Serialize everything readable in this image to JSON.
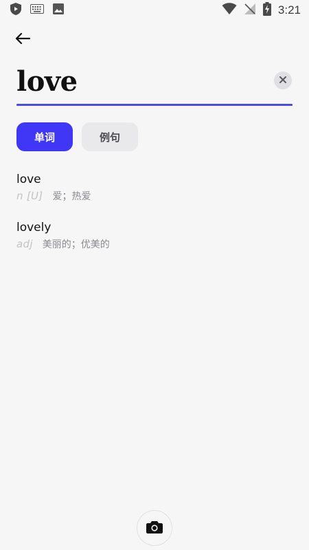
{
  "status_bar": {
    "time": "3:21",
    "left_icons": [
      "shield-play-icon",
      "keyboard-icon",
      "image-icon"
    ],
    "right_icons": [
      "wifi-icon",
      "no-signal-icon",
      "battery-charging-icon"
    ]
  },
  "header": {
    "back_icon": "arrow-left-icon"
  },
  "search": {
    "value": "love",
    "clear_icon": "close-icon",
    "underline_color": "#4a4ee0"
  },
  "tabs": [
    {
      "label": "单词",
      "active": true
    },
    {
      "label": "例句",
      "active": false
    }
  ],
  "results": [
    {
      "word": "love",
      "pos": "n [U]",
      "definition": "爱；热爱"
    },
    {
      "word": "lovely",
      "pos": "adj",
      "definition": "美丽的；优美的"
    }
  ],
  "footer": {
    "camera_icon": "camera-icon"
  },
  "colors": {
    "accent": "#3f37f5",
    "background": "#f6f6f6"
  }
}
